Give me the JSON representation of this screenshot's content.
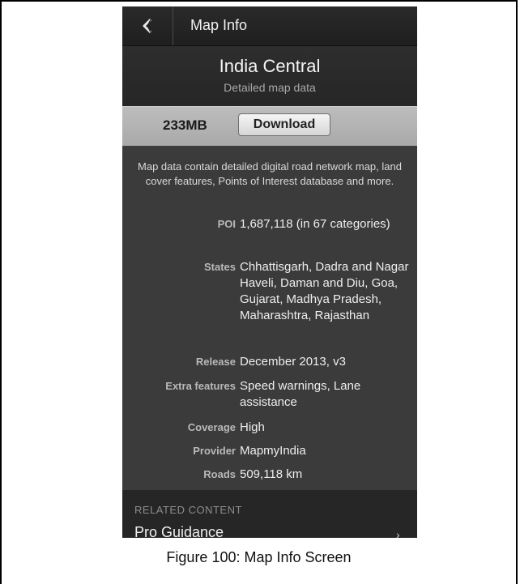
{
  "topbar": {
    "back_icon": "back-chevron-icon",
    "title": "Map Info"
  },
  "header": {
    "map_name": "India Central",
    "subtitle": "Detailed map data"
  },
  "download": {
    "size": "233MB",
    "button_label": "Download"
  },
  "description": "Map data contain detailed digital road network map, land cover features, Points of Interest database and more.",
  "details": [
    {
      "key": "POI",
      "value": "1,687,118 (in 67 categories)"
    },
    {
      "key": "States",
      "value": "Chhattisgarh, Dadra and Nagar Haveli, Daman and Diu, Goa, Gujarat, Madhya Pradesh, Maharashtra, Rajasthan"
    },
    {
      "key": "Release",
      "value": "December 2013, v3"
    },
    {
      "key": "Extra features",
      "value": "Speed warnings, Lane assistance"
    },
    {
      "key": "Coverage",
      "value": "High"
    },
    {
      "key": "Provider",
      "value": "MapmyIndia"
    },
    {
      "key": "Roads",
      "value": "509,118 km"
    }
  ],
  "related": {
    "title": "RELATED CONTENT",
    "item": "Pro Guidance"
  },
  "caption": "Figure 100: Map Info Screen"
}
